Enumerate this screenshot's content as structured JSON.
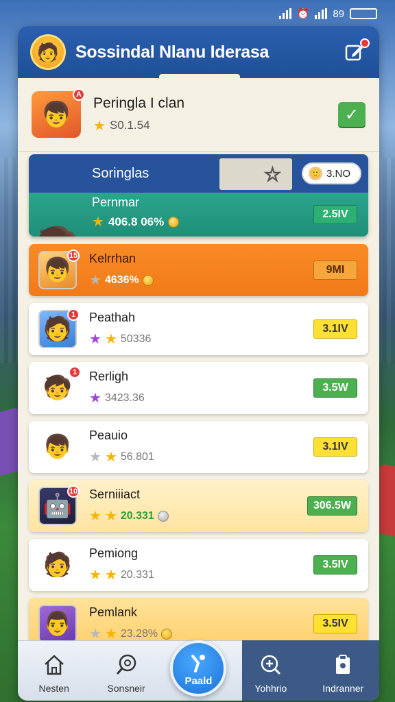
{
  "status_bar": {
    "signal_text": "89",
    "battery_label": ""
  },
  "header": {
    "title": "Sossindal Nlanu Iderasa"
  },
  "profile": {
    "name": "Peringla I clan",
    "score": "S0.1.54"
  },
  "highlight": {
    "top_label": "Soringlas",
    "pill_value": "3.NO",
    "player_name": "Pernmar",
    "player_score": "406.8 06%",
    "value": "2.5IV"
  },
  "rows": [
    {
      "name": "Kelrrhan",
      "score": "4636%",
      "value": "9MI",
      "badge": "15"
    },
    {
      "name": "Peathah",
      "score": "50336",
      "value": "3.1IV",
      "badge": "1"
    },
    {
      "name": "Rerligh",
      "score": "3423.36",
      "value": "3.5W",
      "badge": "1"
    },
    {
      "name": "Peauio",
      "score": "56.801",
      "value": "3.1IV",
      "badge": ""
    },
    {
      "name": "Serniiiact",
      "score": "20.331",
      "value": "306.5W",
      "badge": "10"
    },
    {
      "name": "Pemiong",
      "score": "20.331",
      "value": "3.5IV",
      "badge": ""
    },
    {
      "name": "Pemlank",
      "score": "23.28%",
      "value": "3.5IV",
      "badge": ""
    }
  ],
  "nav": [
    {
      "label": "Nesten",
      "icon": "home-icon"
    },
    {
      "label": "Sonsneir",
      "icon": "search-icon"
    },
    {
      "label": "Paald",
      "icon": "play-icon"
    },
    {
      "label": "Yohhrio",
      "icon": "magnifier-plus-icon"
    },
    {
      "label": "Indranner",
      "icon": "clipboard-icon"
    }
  ]
}
